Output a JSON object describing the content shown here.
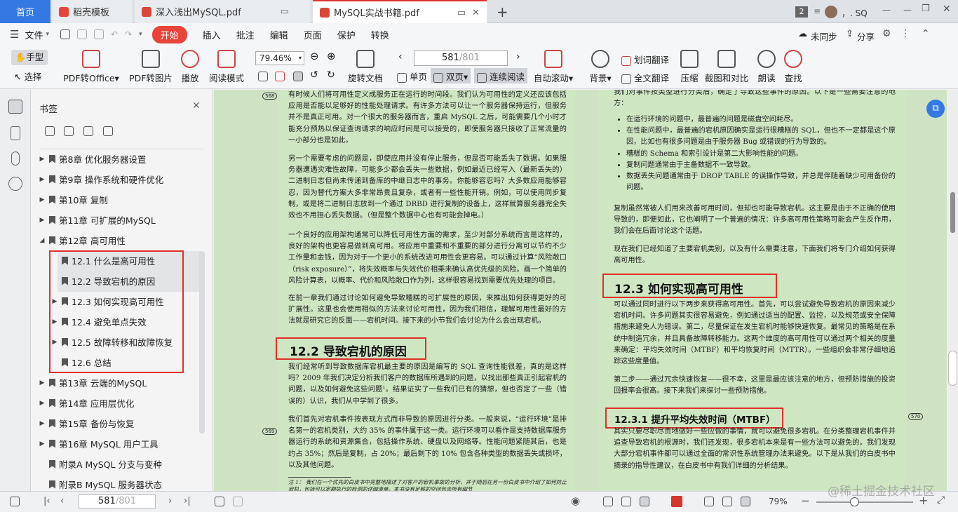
{
  "tabs": {
    "home": "首页",
    "t1": "稻壳模板",
    "t2": "深入浅出MySQL.pdf",
    "t3": "MySQL实战书籍.pdf",
    "new_tab": "+",
    "count_badge": "2",
    "user": "，. SQ"
  },
  "menubar": {
    "file": "文件",
    "items": [
      "开始",
      "插入",
      "批注",
      "编辑",
      "页面",
      "保护",
      "转换"
    ],
    "sync": "未同步",
    "share": "分享"
  },
  "toolbar": {
    "hand": "手型",
    "select": "选择",
    "pdf_office": "PDF转Office",
    "pdf_image": "PDF转图片",
    "play": "播放",
    "read_mode": "阅读模式",
    "zoom": "79.46%",
    "rotate": "旋转文档",
    "page_input": "581",
    "page_total": "/801",
    "single": "单页",
    "double": "双页",
    "continuous": "连续阅读",
    "auto_scroll": "自动滚动",
    "background": "背景",
    "word_translate": "划词翻译",
    "full_translate": "全文翻译",
    "compress": "压缩",
    "screenshot": "截图和对比",
    "read_aloud": "朗读",
    "find": "查找"
  },
  "sidebar": {
    "title": "书签",
    "items": [
      {
        "label": "第8章 优化服务器设置",
        "indent": 0,
        "arrow": "▶"
      },
      {
        "label": "第9章 操作系统和硬件优化",
        "indent": 0,
        "arrow": "▶"
      },
      {
        "label": "第10章 复制",
        "indent": 0,
        "arrow": "▶"
      },
      {
        "label": "第11章 可扩展的MySQL",
        "indent": 0,
        "arrow": "▶"
      },
      {
        "label": "第12章 高可用性",
        "indent": 0,
        "arrow": "◢"
      },
      {
        "label": "12.1 什么是高可用性",
        "indent": 1,
        "arrow": ""
      },
      {
        "label": "12.2 导致宕机的原因",
        "indent": 1,
        "arrow": ""
      },
      {
        "label": "12.3 如何实现高可用性",
        "indent": 1,
        "arrow": "▶"
      },
      {
        "label": "12.4 避免单点失效",
        "indent": 1,
        "arrow": "▶"
      },
      {
        "label": "12.5 故障转移和故障恢复",
        "indent": 1,
        "arrow": "▶"
      },
      {
        "label": "12.6 总结",
        "indent": 1,
        "arrow": ""
      },
      {
        "label": "第13章 云端的MySQL",
        "indent": 0,
        "arrow": "▶"
      },
      {
        "label": "第14章 应用层优化",
        "indent": 0,
        "arrow": "▶"
      },
      {
        "label": "第15章 备份与恢复",
        "indent": 0,
        "arrow": "▶"
      },
      {
        "label": "第16章 MySQL 用户工具",
        "indent": 0,
        "arrow": "▶"
      },
      {
        "label": "附录A MySQL 分支与变种",
        "indent": 0,
        "arrow": ""
      },
      {
        "label": "附录B MySQL 服务器状态",
        "indent": 0,
        "arrow": ""
      }
    ]
  },
  "page_left": {
    "tag_top": "568",
    "tag_mid": "569",
    "p1": "有时候人们将可用性定义成服务正在运行的时间段。我们认为可用性的定义还应该包括应用是否能以足够好的性能处理请求。有许多方法可以让一个服务器保持运行，但服务并不是真正可用。对一个很大的服务器而言，重启 MySQL 之后，可能需要几个小时才能充分预热以保证查询请求的响应时间是可以接受的，即使服务器只接收了正常流量的一小部分也是如此。",
    "p2": "另一个需要考虑的问题是，即使应用并没有停止服务，但是否可能丢失了数据。如果服务器遭遇灾难性故障，可能多少都会丢失一些数据，例如最近已经写入（最新丢失的）二进制日志但尚未传递到备库的中继日志中的事务。你能够容忍吗？大多数应用能够容忍，因为替代方案大多非常昂贵且复杂，或者有一些性能开销。例如，可以使用同步复制，或是将二进制日志放到一个通过 DRBD 进行复制的设备上，这样就算服务器完全失效也不用担心丢失数据。（但是整个数据中心也有可能会掉电。）",
    "p3": "一个良好的应用架构通常可以降低可用性方面的需求，至少对部分系统而言是这样的，良好的架构也更容易做到高可用。将应用中重要和不重要的部分进行分离可以节约不少工作量和金钱，因为对于一个更小的系统改进可用性会更容易。可以通过计算“风险敞口（risk exposure）”，将失效概率与失效代价相乘来确认高优先级的风险。画一个简单的风险计算表，以概率、代价和风险敞口作为列，这样很容易找到需要优先处理的项目。",
    "p4": "在前一章我们通过讨论如何避免导致糟糕的可扩展性的原因，来推出如何获得更好的可扩展性。这里也会使用相似的方法来讨论可用性，因为我们相信，理解可用性最好的方法就是研究它的反面——宕机时间。接下来的小节我们会讨论为什么会出现宕机。",
    "h2": "12.2  导致宕机的原因",
    "p5": "我们经常听到导致数据库宕机最主要的原因是编写的 SQL 查询性能很差，真的是这样吗？2009 年我们决定分析我们客户的数据库所遇到的问题，以找出那些真正引起宕机的问题，以及如何避免这些问题¹。结果证实了一些我们已有的猜想，但也否定了一些（错误的）认识，我们从中学到了很多。",
    "p6": "我们首先对宕机事件按表现方式而非导致的原因进行分类。一般来说，“运行环境”是排名第一的宕机类别，大约 35% 的事件属于这一类。运行环境可以看作是支持数据库服务器运行的系统和资源集合，包括操作系统、硬盘以及网络等。性能问题紧随其后，也是约占 35%；然后是复制，占 20%；最后剩下的 10% 包含各种类型的数据丢失或损坏，以及其他问题。",
    "note": "注 1：  我们在一个优先的白皮书中完整地描述了对客户的宕机事故的分析，并于随后在另一份白皮书中介绍了如何防止宕机，包括可以定期执行的检测的详细清单。本书没有足够的空间包含所有细节"
  },
  "page_right": {
    "tag": "570",
    "p0": "我们对事件按类型进行分类后，确定了导致这些事件的原因。以下是一些需要注意的地方：",
    "bullets": [
      "在运行环境的问题中，最普遍的问题是磁盘空间耗尽。",
      "在性能问题中，最普遍的宕机原因确实是运行很糟糕的 SQL，但也不一定都是这个原因，比如也有很多问题是由于服务器 Bug 或错误的行为导致的。",
      "糟糕的 Schema 和索引设计是第二大影响性能的问题。",
      "复制问题通常由于主备数据不一致导致。",
      "数据丢失问题通常由于 DROP TABLE 的误操作导致，并总是伴随着缺少可用备份的问题。"
    ],
    "p1": "复制虽然常被人们用来改善可用时间，但却也可能导致宕机。这主要是由于不正确的使用导致的，即便如此，它也阐明了一个普遍的情况：许多高可用性策略可能会产生反作用，我们会在后面讨论这个话题。",
    "p2": "现在我们已经知道了主要宕机类别，以及有什么需要注意，下面我们将专门介绍如何获得高可用性。",
    "h2": "12.3  如何实现高可用性",
    "p3": "可以通过同时进行以下两步来获得高可用性。首先，可以尝试避免导致宕机的原因来减少宕机时间。许多问题其实很容易避免，例如通过适当的配置、监控，以及规范或安全保障措施来避免人为错误。第二，尽量保证在发生宕机时能够快速恢复。最常见的策略是在系统中制造冗余，并且具备故障转移能力。这两个维度的高可用性可以通过两个相关的度量来确定：平均失效时间（MTBF）和平均恢复时间（MTTR）。一些组织会非常仔细地追踪这些度量值。",
    "p4": "第二步——通过冗余快速恢复——很不幸，这里是最应该注意的地方，但预防措施的投资回报率会很高。接下来我们来探讨一些预防措施。",
    "h3": "12.3.1  提升平均失效时间（MTBF）",
    "p5": "其实只要尽职尽责地做好一些应做的事情，就可以避免很多宕机。在分类整理宕机事件并追查导致宕机的根源时，我们还发现，很多宕机本来是有一些方法可以避免的。我们发现大部分宕机事件都可以通过全面的常识性系统管理办法来避免。以下是从我们的白皮书中摘录的指导性建议，在白皮书中有我们详细的分析结果。"
  },
  "status": {
    "page": "581",
    "total": "/801",
    "zoom": "79%",
    "watermark": "@稀土掘金技术社区"
  }
}
